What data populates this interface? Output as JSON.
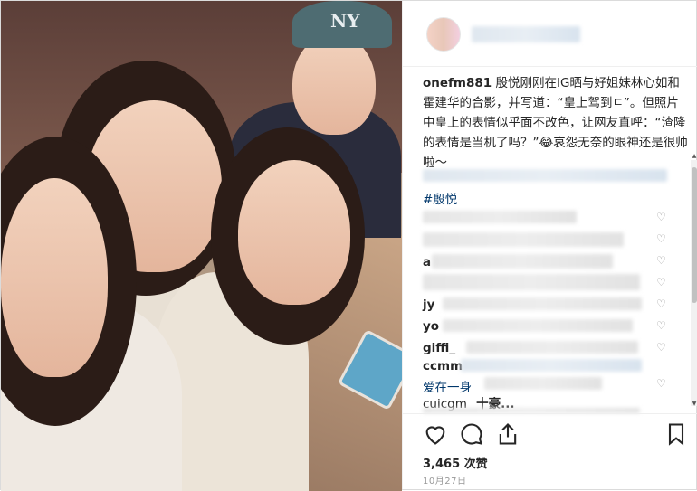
{
  "photo": {
    "cap_logo": "NY"
  },
  "post": {
    "caption_user": "onefm881",
    "caption_text": " 殷悦刚刚在IG晒与好姐妹林心如和霍建华的合影，并写道：“皇上驾到ㄷ”。但照片中皇上的表情似乎面不改色，让网友直呼：“渣隆的表情是当机了吗？”😂哀怨无奈的眼神还是很帅啦～",
    "hashtag": "#殷悦"
  },
  "comments": [
    {
      "user": "",
      "text": ""
    },
    {
      "user": "",
      "text": ""
    },
    {
      "user": "a",
      "text": ""
    },
    {
      "user": "",
      "text": ""
    },
    {
      "user": "jy",
      "text": ""
    },
    {
      "user": "yo",
      "text": ""
    },
    {
      "user": "giffi_",
      "text": ""
    },
    {
      "user": "ccmm",
      "text": ""
    },
    {
      "user": "爱在一身",
      "text": ""
    },
    {
      "user": "cuicgm",
      "text": "十豪..."
    }
  ],
  "actions": {
    "like_icon": "heart-icon",
    "comment_icon": "comment-icon",
    "share_icon": "share-icon",
    "save_icon": "bookmark-icon"
  },
  "stats": {
    "likes": "3,465 次赞",
    "date": "10月27日"
  },
  "colors": {
    "link": "#00376b",
    "text": "#262626",
    "muted": "#999999"
  }
}
